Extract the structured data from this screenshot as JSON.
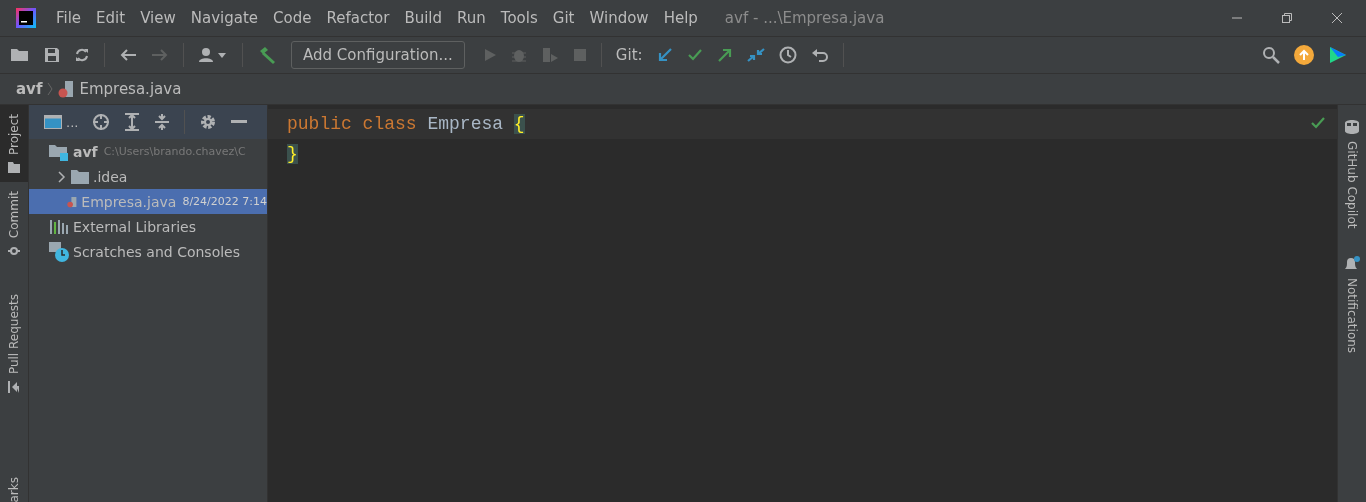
{
  "window": {
    "title": "avf - ...\\Empresa.java"
  },
  "menu": [
    "File",
    "Edit",
    "View",
    "Navigate",
    "Code",
    "Refactor",
    "Build",
    "Run",
    "Tools",
    "Git",
    "Window",
    "Help"
  ],
  "toolbar": {
    "configuration": "Add Configuration...",
    "git_label": "Git:"
  },
  "breadcrumb": [
    "avf",
    "Empresa.java"
  ],
  "left_tabs": [
    {
      "label": "Project",
      "selected": true
    },
    {
      "label": "Commit",
      "selected": false
    },
    {
      "label": "Pull Requests",
      "selected": false
    },
    {
      "label": "arks",
      "selected": false
    }
  ],
  "project_header": {
    "title": "..."
  },
  "tree": [
    {
      "name": "avf",
      "detail": "C:\\Users\\brando.chavez\\C",
      "kind": "module",
      "selected": false,
      "children": [
        {
          "name": ".idea",
          "kind": "folder",
          "selected": false,
          "expanded": false
        },
        {
          "name": "Empresa.java",
          "detail": "8/24/2022 7:14",
          "kind": "java",
          "selected": true
        }
      ]
    },
    {
      "name": "External Libraries",
      "kind": "libraries",
      "selected": false
    },
    {
      "name": "Scratches and Consoles",
      "kind": "scratches",
      "selected": false
    }
  ],
  "editor": {
    "lines": [
      [
        {
          "text": "public",
          "kind": "keyword"
        },
        {
          "text": "class",
          "kind": "keyword"
        },
        {
          "text": "Empresa",
          "kind": "ident"
        },
        {
          "text": "{",
          "kind": "brace"
        }
      ],
      [
        {
          "text": "}",
          "kind": "brace"
        }
      ]
    ]
  },
  "right_tabs": [
    {
      "label": "GitHub Copilot",
      "kind": "copilot"
    },
    {
      "label": "Notifications",
      "kind": "bell"
    }
  ]
}
